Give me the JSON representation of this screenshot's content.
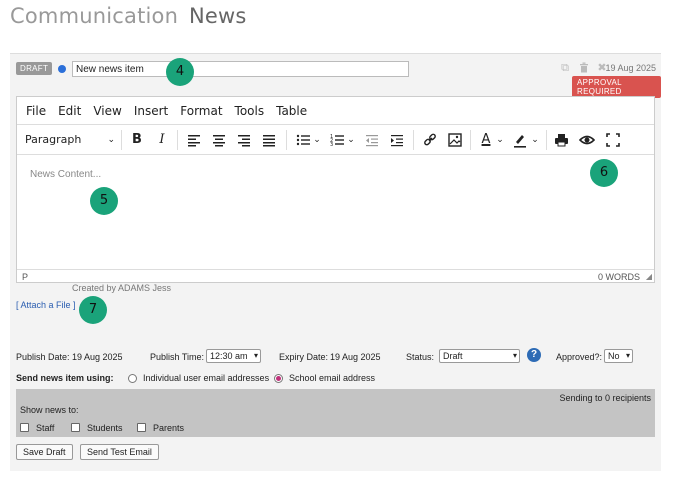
{
  "header": {
    "title": "Communication",
    "subtitle": "News"
  },
  "item": {
    "badge": "DRAFT",
    "title_value": "New news item",
    "date": "19 Aug 2025",
    "approval_badge": "APPROVAL REQUIRED"
  },
  "editor": {
    "menu": [
      "File",
      "Edit",
      "View",
      "Insert",
      "Format",
      "Tools",
      "Table"
    ],
    "block_format": "Paragraph",
    "placeholder": "News Content...",
    "status_path": "P",
    "word_count": "0 WORDS",
    "icons": [
      "bold-icon",
      "italic-icon",
      "align-left-icon",
      "align-center-icon",
      "align-right-icon",
      "align-justify-icon",
      "bullet-list-icon",
      "numbered-list-icon",
      "outdent-icon",
      "indent-icon",
      "link-icon",
      "image-icon",
      "text-color-icon",
      "highlight-icon",
      "print-icon",
      "preview-icon",
      "fullscreen-icon"
    ]
  },
  "created_by": "Created by ADAMS Jess",
  "attach_link": "[ Attach a File ]",
  "publish": {
    "date_label": "Publish Date:",
    "date_value": "19 Aug 2025",
    "time_label": "Publish Time:",
    "time_value": "12:30 am",
    "expiry_label": "Expiry Date:",
    "expiry_value": "19 Aug 2025",
    "status_label": "Status:",
    "status_value": "Draft",
    "approved_label": "Approved?:",
    "approved_value": "No"
  },
  "send": {
    "label": "Send news item using:",
    "option_individual": "Individual user email addresses",
    "option_school": "School email address",
    "selected": "School email address"
  },
  "audience": {
    "sending": "Sending to 0 recipients",
    "show_label": "Show news to:",
    "staff": "Staff",
    "students": "Students",
    "parents": "Parents"
  },
  "buttons": {
    "save_draft": "Save Draft",
    "send_test": "Send Test Email"
  },
  "markers": [
    "4",
    "5",
    "6",
    "7"
  ],
  "colors": {
    "approval": "#d9534f",
    "marker": "#1aa37a",
    "accent_dot": "#2b6fd9",
    "link": "#2a5db0",
    "radio_selected": "#c0307a"
  }
}
